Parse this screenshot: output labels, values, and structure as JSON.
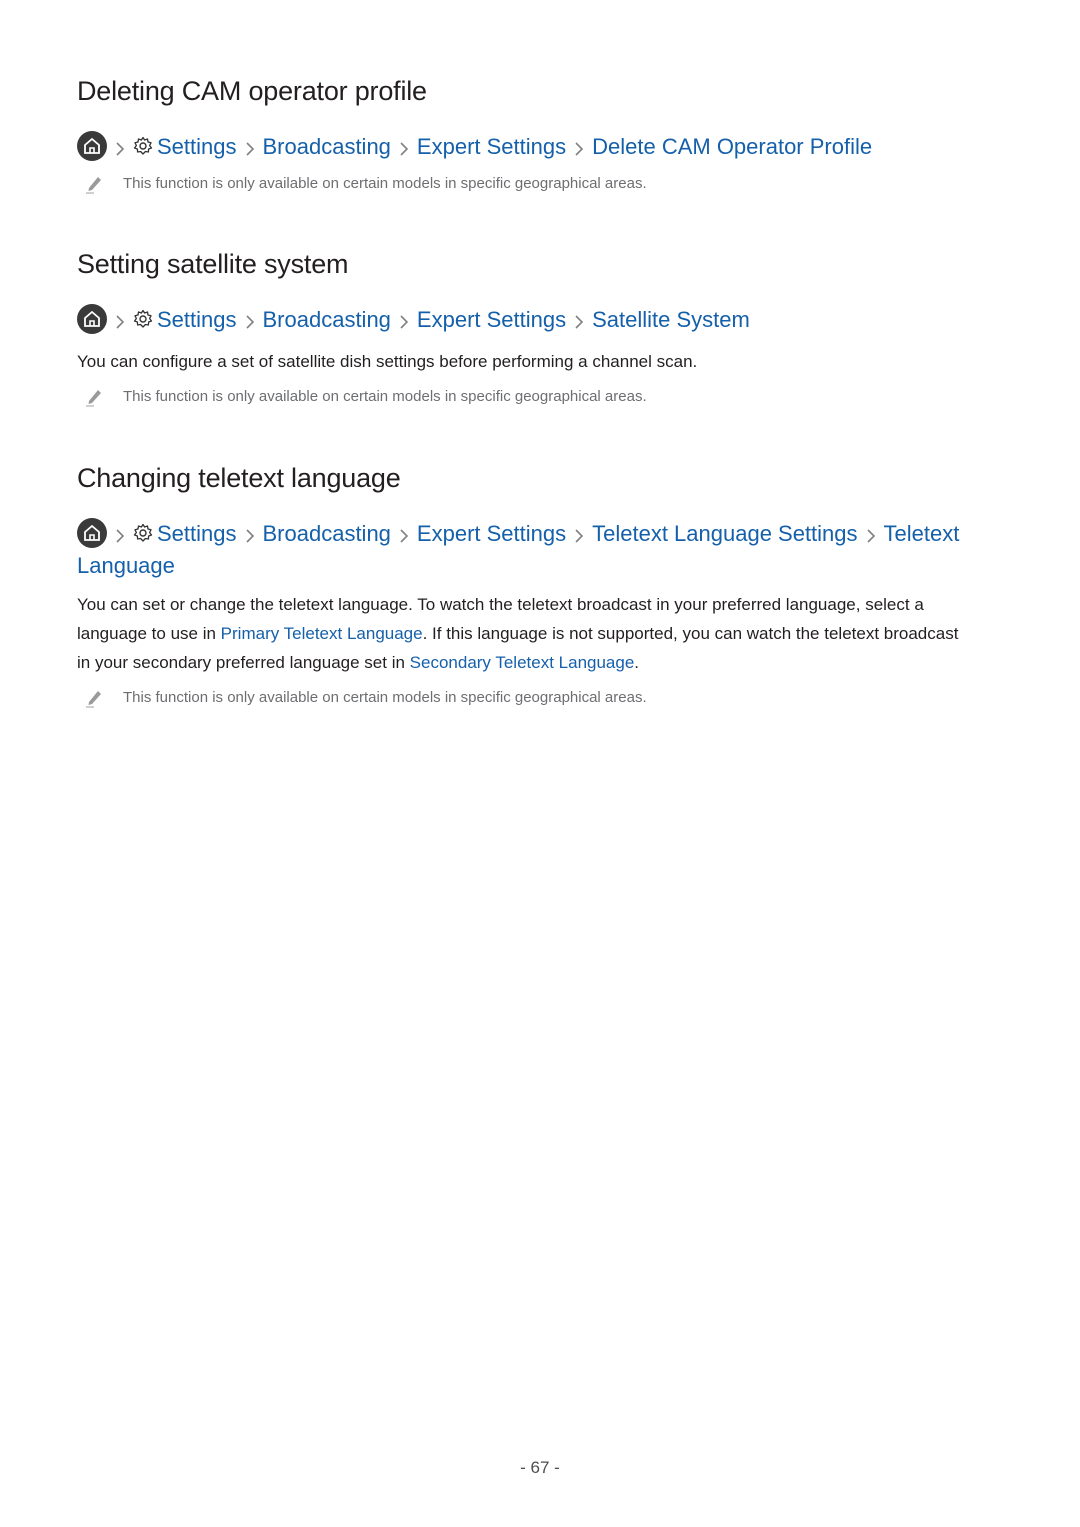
{
  "sections": [
    {
      "title": "Deleting CAM operator profile",
      "path": [
        "Settings",
        "Broadcasting",
        "Expert Settings",
        "Delete CAM Operator Profile"
      ],
      "note": "This function is only available on certain models in specific geographical areas."
    },
    {
      "title": "Setting satellite system",
      "path": [
        "Settings",
        "Broadcasting",
        "Expert Settings",
        "Satellite System"
      ],
      "body": "You can configure a set of satellite dish settings before performing a channel scan.",
      "note": "This function is only available on certain models in specific geographical areas."
    },
    {
      "title": "Changing teletext language",
      "path": [
        "Settings",
        "Broadcasting",
        "Expert Settings",
        "Teletext Language Settings",
        "Teletext Language"
      ],
      "body_parts": {
        "p1": "You can set or change the teletext language. To watch the teletext broadcast in your preferred language, select a language to use in ",
        "link1": "Primary Teletext Language",
        "p2": ". If this language is not supported, you can watch the teletext broadcast in your secondary preferred language set in ",
        "link2": "Secondary Teletext Language",
        "p3": "."
      },
      "note": "This function is only available on certain models in specific geographical areas."
    }
  ],
  "page_number": "- 67 -",
  "colors": {
    "link": "#1560aa",
    "text": "#231f20",
    "note": "#6d6e71"
  }
}
